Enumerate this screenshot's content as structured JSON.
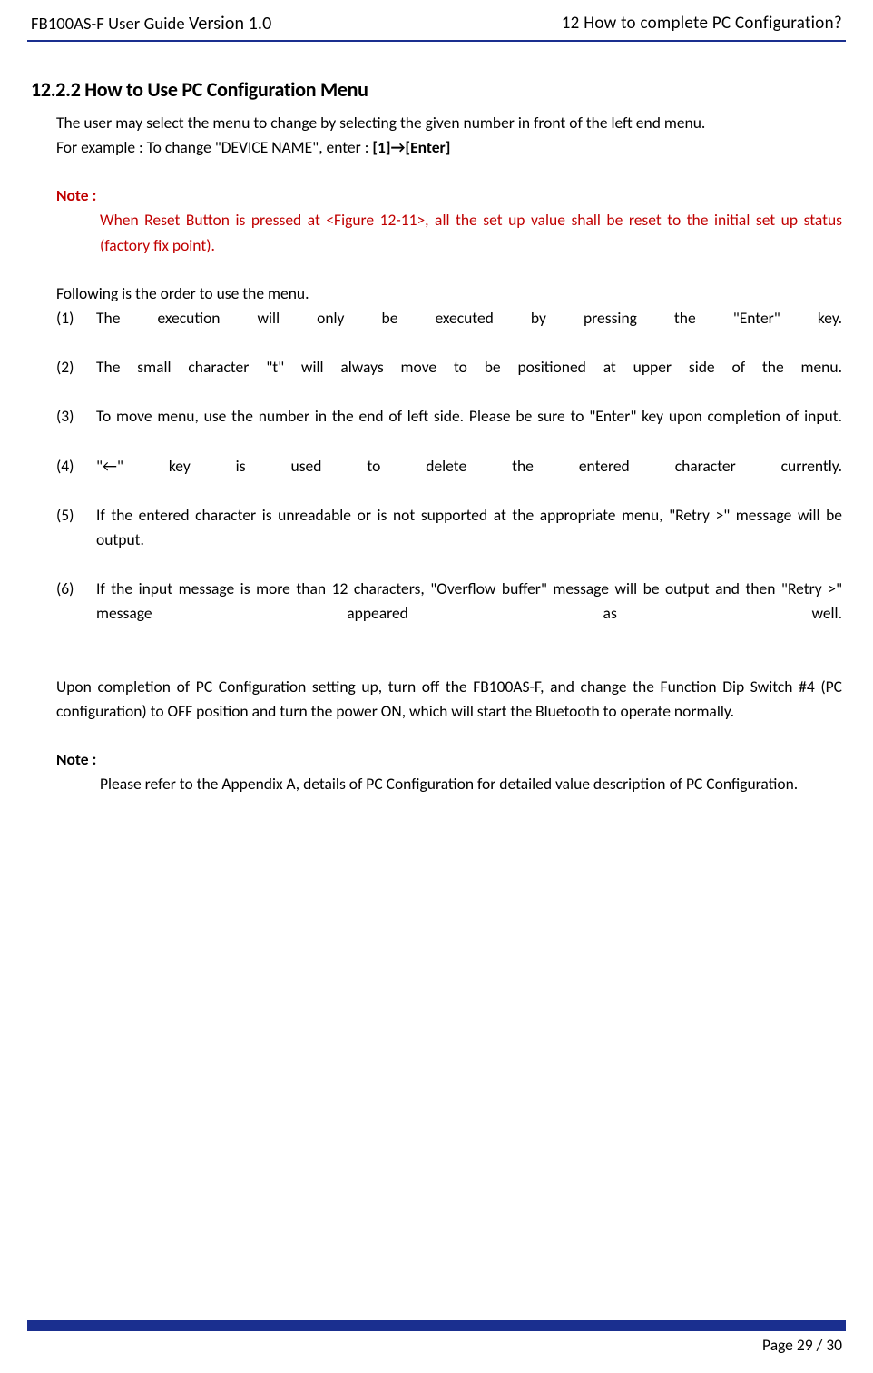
{
  "header": {
    "guideName": "FB100AS-F User Guide",
    "versionLabel": "Version 1.0",
    "sectionNum": "12",
    "sectionTitle": "How to complete PC Configuration?"
  },
  "h2": "12.2.2 How to Use PC Configuration Menu",
  "intro1": "The user may select the menu to change by selecting the given number in front of the left end menu.",
  "intro2_pre": "For example : To change \"DEVICE NAME\", enter : ",
  "intro2_bold": "[1]→[Enter]",
  "noteLabel": "Note :",
  "noteRed": "When Reset Button is pressed at <Figure 12-11>, all the set up value shall be reset to the initial set up status (factory fix point).",
  "followingLine": "Following is the order to use the menu.",
  "list": [
    "The execution will only be executed by pressing the \"Enter\" key.",
    "The small character \"t\" will always move to be positioned at upper side of the menu.",
    "To move menu, use the number in the end of left side.  Please be sure to \"Enter\" key upon completion of input.",
    "\"←\" key is used to delete the entered character currently.",
    "If the entered character is unreadable or is not supported at the appropriate menu, \"Retry >\" message will be output.",
    "If the input message is more than 12 characters, \"Overflow buffer\" message will be output and then \"Retry >\" message appeared as well."
  ],
  "closing": "Upon completion of PC Configuration setting up, turn off the FB100AS-F, and change the Function Dip Switch #4 (PC configuration) to OFF position and turn the power ON, which will start the Bluetooth to operate normally.",
  "note2Label": "Note :",
  "note2Body": "Please refer to the Appendix A, details of PC Configuration for detailed value description of PC Configuration.",
  "footer": {
    "pageLabel": "Page 29 / 30"
  }
}
